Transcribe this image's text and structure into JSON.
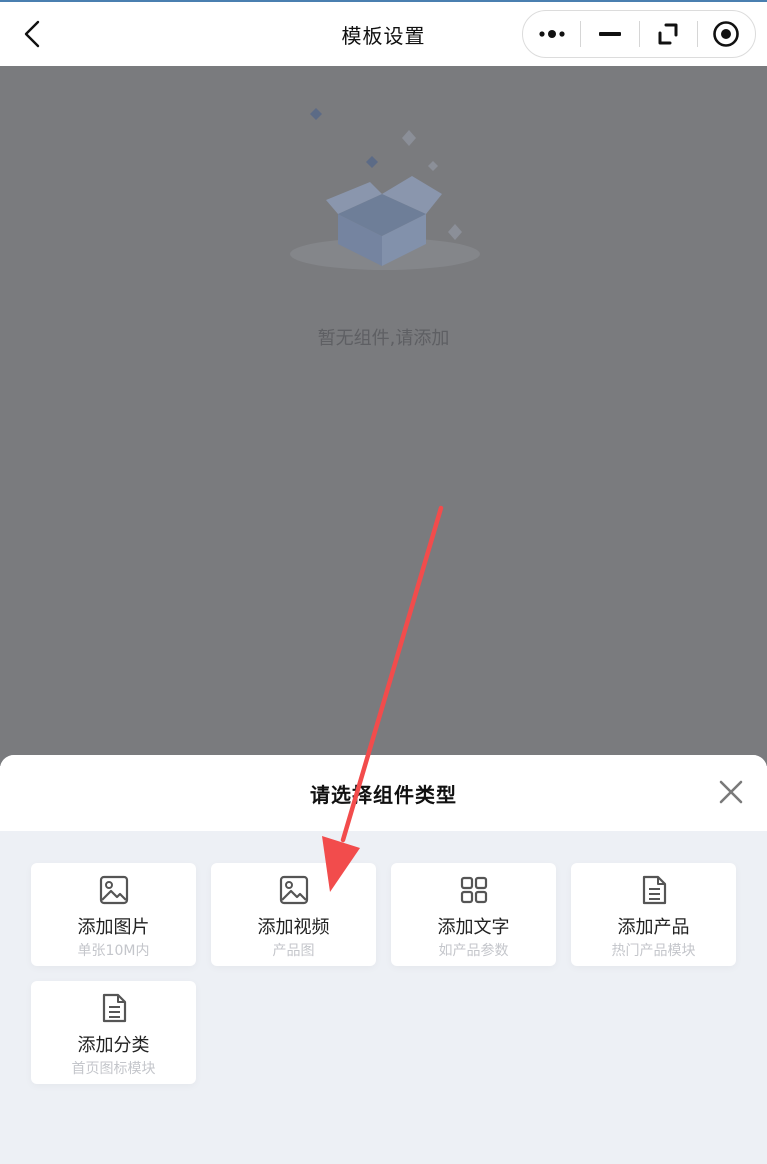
{
  "header": {
    "title": "模板设置",
    "icons": [
      "back-arrow-icon",
      "more-dots-icon",
      "minimize-icon",
      "rotate-icon",
      "record-circle-icon"
    ]
  },
  "main": {
    "empty_text": "暂无组件,请添加",
    "canvas_color": "#7a7b7e"
  },
  "sheet": {
    "title": "请选择组件类型",
    "background": "#edf0f5",
    "cards": [
      {
        "label": "添加图片",
        "sub": "单张10M内",
        "icon": "image-icon"
      },
      {
        "label": "添加视频",
        "sub": "产品图",
        "icon": "image-icon"
      },
      {
        "label": "添加文字",
        "sub": "如产品参数",
        "icon": "grid-icon"
      },
      {
        "label": "添加产品",
        "sub": "热门产品模块",
        "icon": "document-icon"
      },
      {
        "label": "添加分类",
        "sub": "首页图标模块",
        "icon": "document-icon"
      }
    ]
  },
  "annotation": {
    "arrow_color": "#f24c4c"
  }
}
